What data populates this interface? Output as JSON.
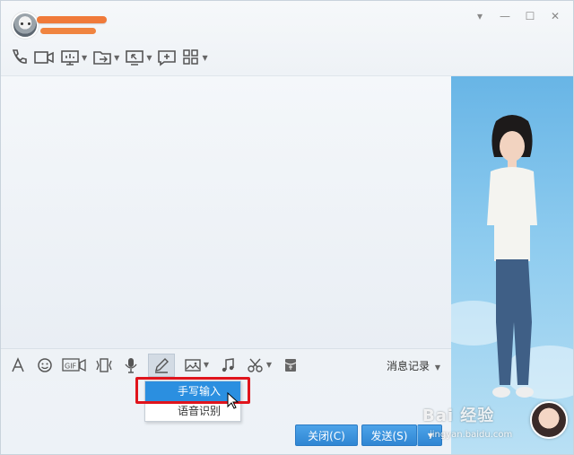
{
  "window": {
    "controls": {
      "dropdown": "▾",
      "minimize": "—",
      "maximize": "☐",
      "close": "✕"
    }
  },
  "header_tools": [
    {
      "name": "phone-call",
      "icon": "phone-icon"
    },
    {
      "name": "video-call",
      "icon": "video-icon"
    },
    {
      "name": "screen-share",
      "icon": "monitor-icon",
      "has_caret": true
    },
    {
      "name": "send-file",
      "icon": "folder-icon",
      "has_caret": true
    },
    {
      "name": "remote-assist",
      "icon": "screen-remote-icon",
      "has_caret": true
    },
    {
      "name": "add-chat",
      "icon": "chat-plus-icon"
    },
    {
      "name": "apps",
      "icon": "grid-icon",
      "has_caret": true
    }
  ],
  "input_toolbar": {
    "history_label": "消息记录",
    "gif_label": "GIF"
  },
  "menu": {
    "items": [
      {
        "label": "手写输入",
        "highlighted": true
      },
      {
        "label": "语音识别",
        "highlighted": false
      }
    ]
  },
  "buttons": {
    "close_label": "关闭(C)",
    "send_label": "发送(S)"
  },
  "watermark": {
    "text": "Bai 经验",
    "sub": "jingyan.baidu.com"
  },
  "colors": {
    "accent": "#2b8fe0",
    "highlight_frame": "#e0141c",
    "side_bg": "#8fccef"
  }
}
